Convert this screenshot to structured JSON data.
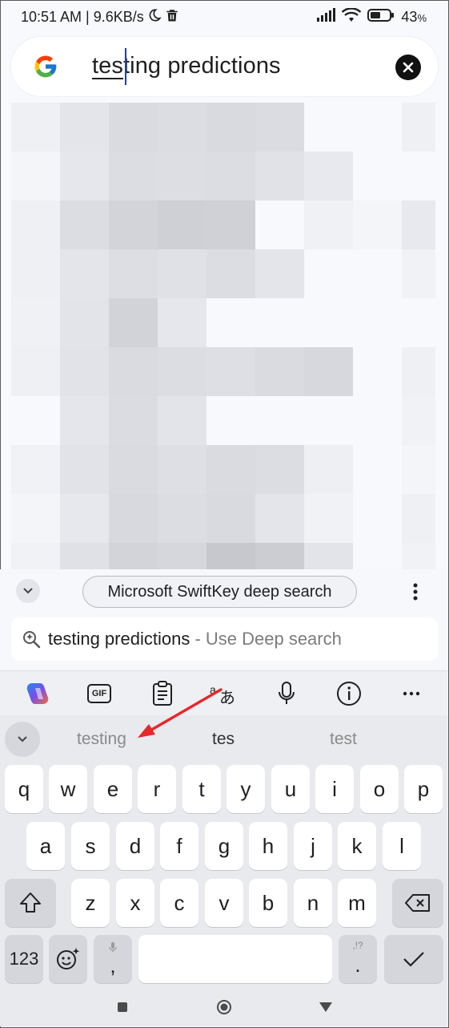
{
  "status_bar": {
    "time_speed": "10:51 AM | 9.6KB/s",
    "battery_percent": "43",
    "battery_suffix": "%",
    "icons": [
      "moon-icon",
      "trash-icon",
      "signal-icon",
      "wifi-icon",
      "battery-icon"
    ]
  },
  "search": {
    "query_underlined": "tes",
    "query_rest": "ting predictions",
    "logo_icon": "google-g-logo",
    "clear_icon": "clear-icon"
  },
  "blur_colors": [
    [
      "#eef0f4",
      "#e4e5ea",
      "#dadbe0",
      "#dcdde2",
      "#d9dadf",
      "#dbdce1",
      "#f8f9fc",
      "#f8f9fc",
      "#eef0f4"
    ],
    [
      "#f4f5f8",
      "#e6e7ec",
      "#dcdde2",
      "#dddee3",
      "#dcdde2",
      "#e1e2e7",
      "#e8e9ee",
      "#f8f9fc",
      "#f8f9fc"
    ],
    [
      "#eef0f4",
      "#dcdde2",
      "#d3d4d9",
      "#cfd0d5",
      "#d0d1d6",
      "#f8f9fc",
      "#f0f1f5",
      "#f4f5f8",
      "#e8e9ee"
    ],
    [
      "#eef0f4",
      "#e4e5ea",
      "#dddee3",
      "#e0e1e6",
      "#dcdde2",
      "#e4e5ea",
      "#f8f9fc",
      "#f8f9fc",
      "#f1f2f6"
    ],
    [
      "#f0f1f5",
      "#e3e4e9",
      "#d2d3d8",
      "#e6e7ec",
      "#f8f9fc",
      "#f8f9fc",
      "#f8f9fc",
      "#f8f9fc",
      "#f8f9fc"
    ],
    [
      "#eef0f4",
      "#e2e3e8",
      "#dadbe0",
      "#dcdde2",
      "#dedfe4",
      "#dadbe0",
      "#d7d8dd",
      "#f8f9fc",
      "#eef0f4"
    ],
    [
      "#f8f9fc",
      "#e5e6eb",
      "#dbdce1",
      "#e3e4e9",
      "#f8f9fc",
      "#f8f9fc",
      "#f8f9fc",
      "#f8f9fc",
      "#f1f2f6"
    ],
    [
      "#f1f2f6",
      "#e2e3e8",
      "#dadbe0",
      "#dedfe4",
      "#dadbe0",
      "#dcdde2",
      "#eeeff3",
      "#f8f9fc",
      "#f4f5f8"
    ],
    [
      "#f4f5f8",
      "#e7e8ed",
      "#d8d9de",
      "#dcdde2",
      "#d9dadf",
      "#e4e5ea",
      "#f1f2f6",
      "#f8f9fc",
      "#eef0f4"
    ],
    [
      "#f1f2f6",
      "#e0e1e6",
      "#d3d4d9",
      "#d6d7dc",
      "#c7c8cd",
      "#cbcdd2",
      "#e3e4e9",
      "#f8f9fc",
      "#f1f2f6"
    ]
  ],
  "swiftkey": {
    "collapse_icon": "chevron-down-icon",
    "deep_search_label": "Microsoft SwiftKey deep search",
    "more_icon": "more-vert-icon",
    "deep_row_query": "testing predictions",
    "deep_row_hint": " - Use Deep search"
  },
  "toolbar": {
    "icons": [
      "copilot-icon",
      "gif-icon",
      "clipboard-icon",
      "translate-icon",
      "mic-icon",
      "info-icon",
      "more-horiz-icon"
    ],
    "gif_label": "GIF",
    "translate_label": "あ"
  },
  "predictions": [
    "testing",
    "tes",
    "test"
  ],
  "keyboard": {
    "row1": [
      "q",
      "w",
      "e",
      "r",
      "t",
      "y",
      "u",
      "i",
      "o",
      "p"
    ],
    "row2": [
      "a",
      "s",
      "d",
      "f",
      "g",
      "h",
      "j",
      "k",
      "l"
    ],
    "row3": [
      "z",
      "x",
      "c",
      "v",
      "b",
      "n",
      "m"
    ],
    "numbers_label": "123",
    "comma_label": ",",
    "period_label": ".",
    "period_hint": ",!?",
    "accent": "#ffffff"
  },
  "annotation": {
    "color": "#e8262b"
  }
}
